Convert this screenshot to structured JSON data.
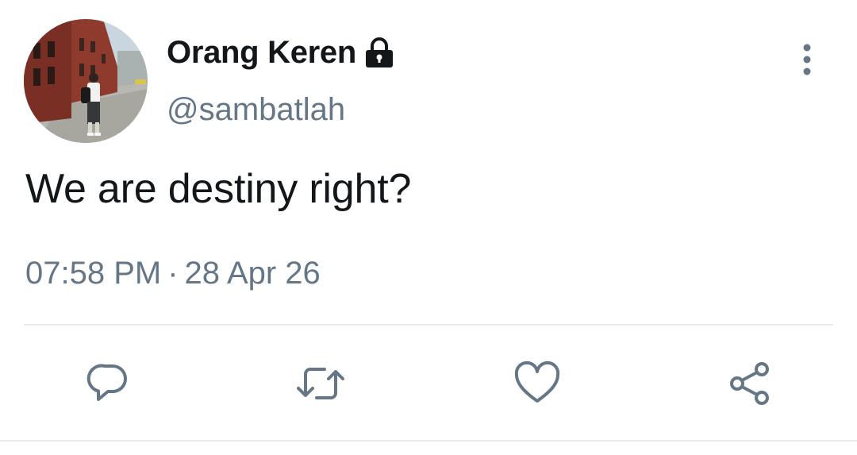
{
  "tweet": {
    "display_name": "Orang Keren",
    "handle": "@sambatlah",
    "text": "We are destiny right?",
    "time": "07:58 PM",
    "separator": "·",
    "date": "28 Apr 26"
  },
  "icons": {
    "protected": "lock-icon",
    "more": "more-vertical-icon",
    "reply": "reply-icon",
    "retweet": "retweet-icon",
    "like": "heart-icon",
    "share": "share-icon"
  },
  "colors": {
    "text_primary": "#14171a",
    "text_secondary": "#657786",
    "divider": "#e6ecf0"
  }
}
